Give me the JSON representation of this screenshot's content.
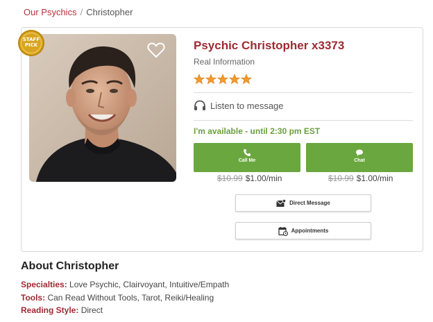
{
  "breadcrumb": {
    "parent": "Our Psychics",
    "separator": "/",
    "current": "Christopher"
  },
  "badge": {
    "line1": "STAFF",
    "line2": "PICK"
  },
  "profile": {
    "name": "Psychic Christopher x3373",
    "subtitle": "Real Information",
    "rating_stars": 5,
    "listen_label": "Listen to message",
    "availability": "I'm available - until 2:30 pm EST"
  },
  "call": {
    "label": "Call Me",
    "old_price": "$10.99",
    "price": "$1.00/min"
  },
  "chat": {
    "label": "Chat",
    "old_price": "$10.99",
    "price": "$1.00/min"
  },
  "actions": {
    "direct_message": "Direct Message",
    "appointments": "Appointments"
  },
  "about": {
    "heading": "About Christopher",
    "specialties_label": "Specialties:",
    "specialties": "Love Psychic, Clairvoyant, Intuitive/Empath",
    "tools_label": "Tools:",
    "tools": "Can Read Without Tools, Tarot, Reiki/Healing",
    "style_label": "Reading Style:",
    "style": "Direct"
  },
  "colors": {
    "brand_red": "#9e2a31",
    "link_red": "#b5303a",
    "available_green": "#6aa03c",
    "button_green": "#6aa73f",
    "star_orange": "#f29a2e",
    "badge_gold": "#d9a521"
  },
  "icons": [
    "heart-icon",
    "star-icon",
    "headphones-icon",
    "phone-icon",
    "chat-bubble-icon",
    "envelope-icon",
    "calendar-icon"
  ]
}
